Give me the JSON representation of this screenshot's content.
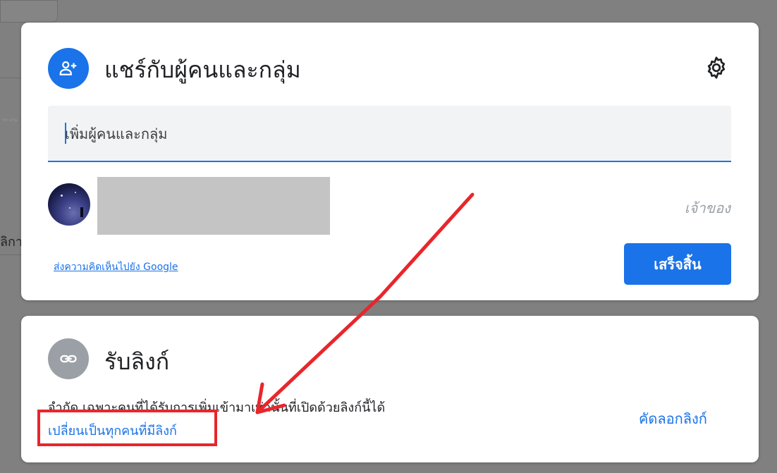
{
  "background": {
    "fragment_text": "ลิกา",
    "tiny_text": "ขา ผ่าน"
  },
  "share_card": {
    "title": "แชร์กับผู้คนและกลุ่ม",
    "add_people_placeholder": "เพิ่มผู้คนและกลุ่ม",
    "owner_role": "เจ้าของ",
    "feedback_link": "ส่งความคิดเห็นไปยัง Google",
    "done_button": "เสร็จสิ้น",
    "icons": [
      "person-add-icon",
      "gear-icon"
    ]
  },
  "link_card": {
    "title": "รับลิงก์",
    "description": "จำกัด เฉพาะคนที่ได้รับการเพิ่มเข้ามาเท่านั้นที่เปิดด้วยลิงก์นี้ได้",
    "change_link": "เปลี่ยนเป็นทุกคนที่มีลิงก์",
    "copy_link": "คัดลอกลิงก์",
    "icons": [
      "link-icon"
    ]
  },
  "colors": {
    "accent": "#1a73e8",
    "annotation": "#e8262b",
    "overlay": "#808080"
  }
}
